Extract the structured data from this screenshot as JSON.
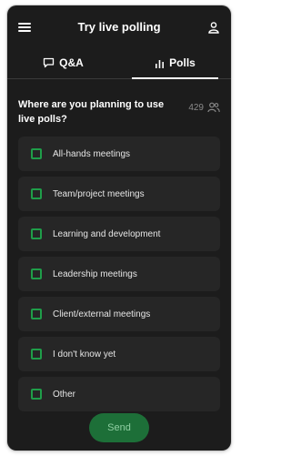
{
  "header": {
    "title": "Try live polling",
    "menu_icon": "hamburger-menu-icon",
    "user_icon": "user-icon"
  },
  "tabs": [
    {
      "label": "Q&A",
      "icon": "speech-bubble-icon",
      "active": false
    },
    {
      "label": "Polls",
      "icon": "bar-chart-icon",
      "active": true
    }
  ],
  "poll": {
    "question": "Where are you planning to use live polls?",
    "vote_count": "429",
    "vote_icon": "people-icon",
    "options": [
      {
        "label": "All-hands meetings"
      },
      {
        "label": "Team/project meetings"
      },
      {
        "label": "Learning and development"
      },
      {
        "label": "Leadership meetings"
      },
      {
        "label": "Client/external meetings"
      },
      {
        "label": "I don't know yet"
      },
      {
        "label": "Other"
      }
    ],
    "send_label": "Send"
  },
  "colors": {
    "background": "#1c1c1c",
    "option_background": "#262626",
    "checkbox_border": "#1f9d49",
    "send_button": "#1d6f38"
  }
}
